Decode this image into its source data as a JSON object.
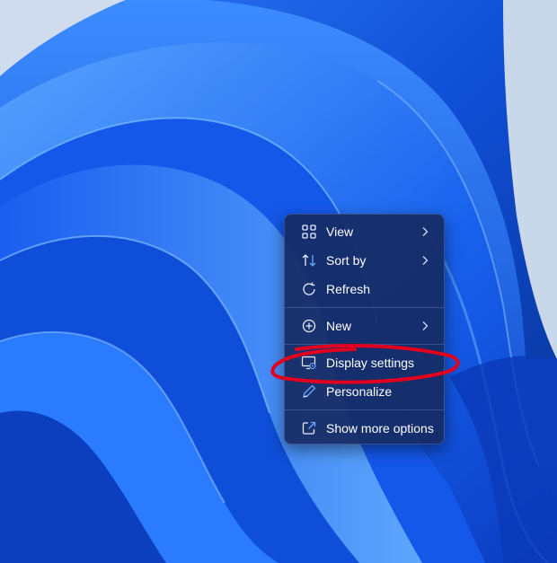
{
  "desktop": {
    "context_menu": {
      "items": [
        {
          "label": "View",
          "icon": "view-grid-icon",
          "submenu": true
        },
        {
          "label": "Sort by",
          "icon": "sort-arrows-icon",
          "submenu": true
        },
        {
          "label": "Refresh",
          "icon": "refresh-icon",
          "submenu": false
        },
        {
          "label": "New",
          "icon": "plus-circle-icon",
          "submenu": true
        },
        {
          "label": "Display settings",
          "icon": "display-settings-icon",
          "submenu": false
        },
        {
          "label": "Personalize",
          "icon": "pen-icon",
          "submenu": false
        },
        {
          "label": "Show more options",
          "icon": "open-external-icon",
          "submenu": false
        }
      ]
    }
  },
  "colors": {
    "menu_background": "#162a62",
    "menu_text": "#ffffff",
    "accent": "#5aa0ff",
    "annotation": "#e1001e"
  }
}
